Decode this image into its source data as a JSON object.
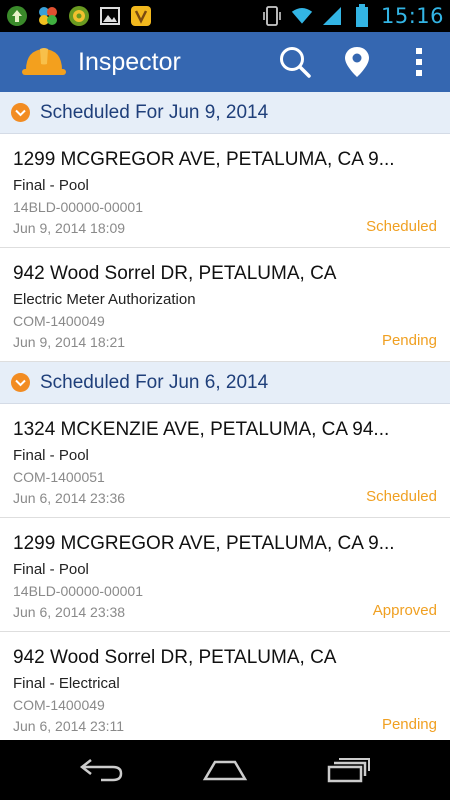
{
  "status_bar": {
    "time": "15:16",
    "left_icons": [
      "upload-icon",
      "windmill-icon",
      "settings-app-icon",
      "gallery-icon",
      "app-icon"
    ],
    "right_icons": [
      "vibrate-icon",
      "wifi-icon",
      "battery-icon"
    ]
  },
  "action_bar": {
    "title": "Inspector",
    "color": "#3567b1",
    "actions": [
      "search-icon",
      "location-pin-icon",
      "overflow-menu-icon"
    ]
  },
  "sections": [
    {
      "title": "Scheduled For Jun 9, 2014",
      "items": [
        {
          "address": "1299 MCGREGOR AVE, PETALUMA, CA 9...",
          "type": "Final - Pool",
          "id": "14BLD-00000-00001",
          "date": "Jun 9, 2014 18:09",
          "status": "Scheduled"
        },
        {
          "address": "942 Wood Sorrel DR, PETALUMA, CA",
          "type": "Electric Meter Authorization",
          "id": "COM-1400049",
          "date": "Jun 9, 2014 18:21",
          "status": "Pending"
        }
      ]
    },
    {
      "title": "Scheduled For Jun 6, 2014",
      "items": [
        {
          "address": "1324 MCKENZIE AVE, PETALUMA, CA 94...",
          "type": "Final - Pool",
          "id": "COM-1400051",
          "date": "Jun 6, 2014 23:36",
          "status": "Scheduled"
        },
        {
          "address": "1299 MCGREGOR AVE, PETALUMA, CA 9...",
          "type": "Final - Pool",
          "id": "14BLD-00000-00001",
          "date": "Jun 6, 2014 23:38",
          "status": "Approved"
        },
        {
          "address": "942 Wood Sorrel DR, PETALUMA, CA",
          "type": "Final - Electrical",
          "id": "COM-1400049",
          "date": "Jun 6, 2014 23:11",
          "status": "Pending"
        }
      ]
    }
  ],
  "nav_bar": [
    "back-icon",
    "home-icon",
    "recent-apps-icon"
  ],
  "colors": {
    "status_text": "#f0a022",
    "section_bg": "#e6eef8",
    "chevron": "#f28c22"
  }
}
